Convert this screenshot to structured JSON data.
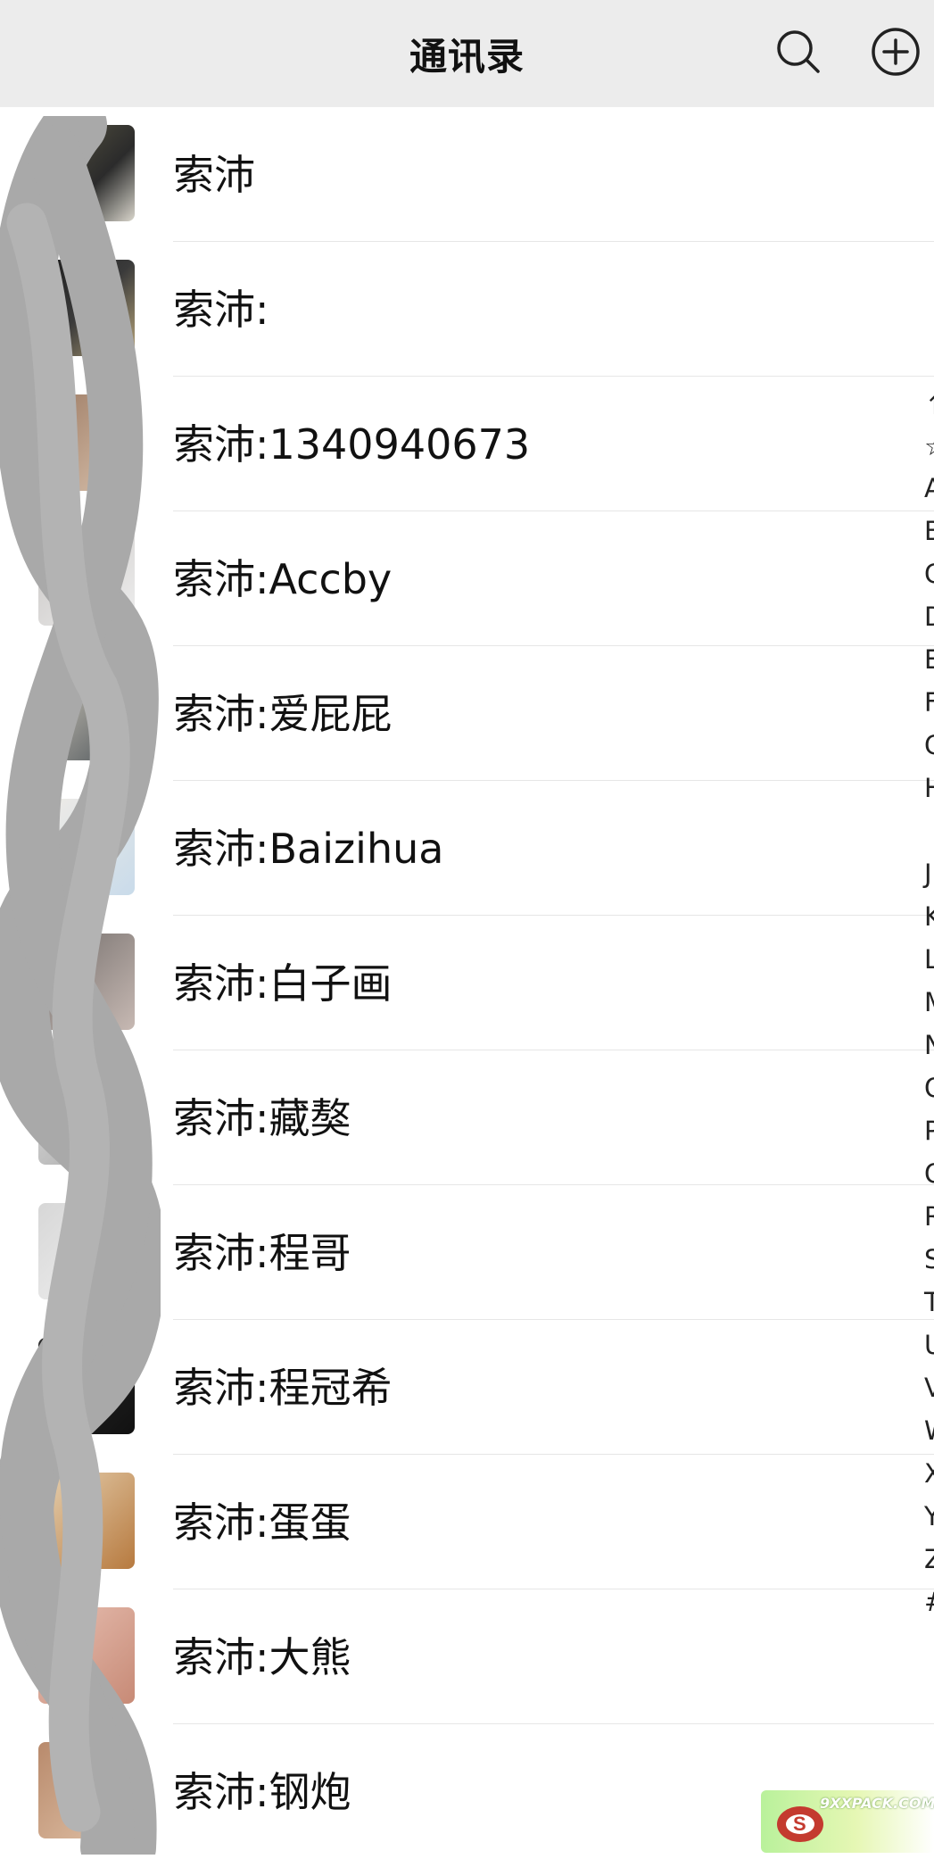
{
  "header": {
    "title": "通讯录",
    "search_icon": "search-icon",
    "add_icon": "add-circle-icon"
  },
  "contacts": [
    {
      "name": "索沛"
    },
    {
      "name": "索沛:"
    },
    {
      "name": "索沛:1340940673"
    },
    {
      "name": "索沛:Accby"
    },
    {
      "name": "索沛:爱屁屁"
    },
    {
      "name": "索沛:Baizihua"
    },
    {
      "name": "索沛:白子画"
    },
    {
      "name": "索沛:藏獒"
    },
    {
      "name": "索沛:程哥"
    },
    {
      "name": "索沛:程冠希"
    },
    {
      "name": "索沛:蛋蛋"
    },
    {
      "name": "索沛:大熊"
    },
    {
      "name": "索沛:钢炮"
    }
  ],
  "alphabet_index": [
    "↑",
    "☆",
    "A",
    "B",
    "C",
    "D",
    "E",
    "F",
    "G",
    "H",
    "J",
    "K",
    "L",
    "M",
    "N",
    "O",
    "P",
    "Q",
    "R",
    "S",
    "T",
    "U",
    "V",
    "W",
    "X",
    "Y",
    "Z",
    "#"
  ],
  "watermark": {
    "text": "9XXPACK.COM"
  },
  "colors": {
    "header_bg": "#ececec",
    "divider": "#e6e6e6",
    "scribble": "#a9a9a9"
  }
}
